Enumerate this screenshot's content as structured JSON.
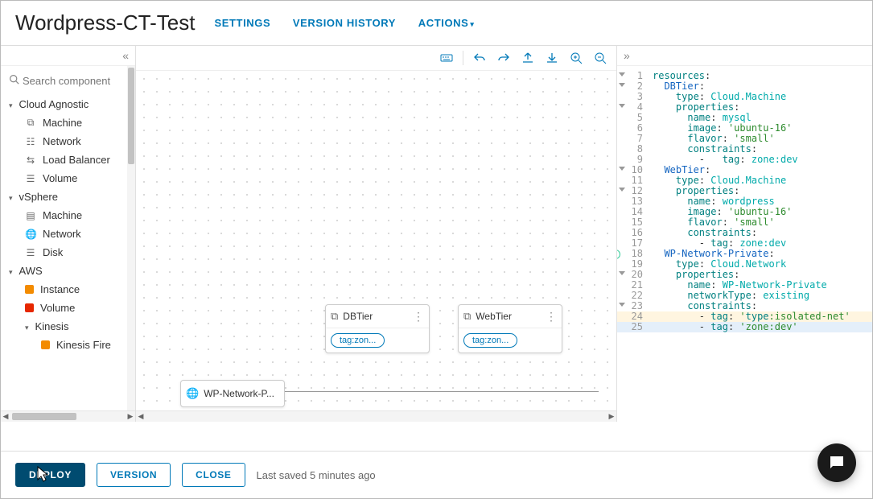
{
  "header": {
    "title": "Wordpress-CT-Test",
    "settings": "SETTINGS",
    "version_history": "VERSION HISTORY",
    "actions": "ACTIONS"
  },
  "sidebar": {
    "search_placeholder": "Search component",
    "groups": [
      {
        "label": "Cloud Agnostic",
        "items": [
          {
            "label": "Machine",
            "icon": "server-icon"
          },
          {
            "label": "Network",
            "icon": "network-icon"
          },
          {
            "label": "Load Balancer",
            "icon": "lb-icon"
          },
          {
            "label": "Volume",
            "icon": "volume-icon"
          }
        ]
      },
      {
        "label": "vSphere",
        "items": [
          {
            "label": "Machine",
            "icon": "server-icon"
          },
          {
            "label": "Network",
            "icon": "globe-icon"
          },
          {
            "label": "Disk",
            "icon": "disk-icon"
          }
        ]
      },
      {
        "label": "AWS",
        "items": [
          {
            "label": "Instance",
            "icon": "aws-orange"
          },
          {
            "label": "Volume",
            "icon": "aws-red"
          },
          {
            "label": "Kinesis",
            "sub": true,
            "items": [
              {
                "label": "Kinesis Fire",
                "icon": "aws-orange"
              }
            ]
          }
        ]
      }
    ]
  },
  "canvas": {
    "nodes": {
      "db": {
        "title": "DBTier",
        "tag": "tag:zon..."
      },
      "web": {
        "title": "WebTier",
        "tag": "tag:zon..."
      },
      "net": {
        "title": "WP-Network-P..."
      }
    }
  },
  "code": {
    "lines": [
      "resources:",
      "  DBTier:",
      "    type: Cloud.Machine",
      "    properties:",
      "      name: mysql",
      "      image: 'ubuntu-16'",
      "      flavor: 'small'",
      "      constraints:",
      "        -   tag: zone:dev",
      "  WebTier:",
      "    type: Cloud.Machine",
      "    properties:",
      "      name: wordpress",
      "      image: 'ubuntu-16'",
      "      flavor: 'small'",
      "      constraints:",
      "        - tag: zone:dev",
      "  WP-Network-Private:",
      "    type: Cloud.Network",
      "    properties:",
      "      name: WP-Network-Private",
      "      networkType: existing",
      "      constraints:",
      "        - tag: 'type:isolated-net'",
      "        - tag: 'zone:dev'"
    ]
  },
  "footer": {
    "deploy": "DEPLOY",
    "version": "VERSION",
    "close": "CLOSE",
    "saved": "Last saved 5 minutes ago"
  }
}
